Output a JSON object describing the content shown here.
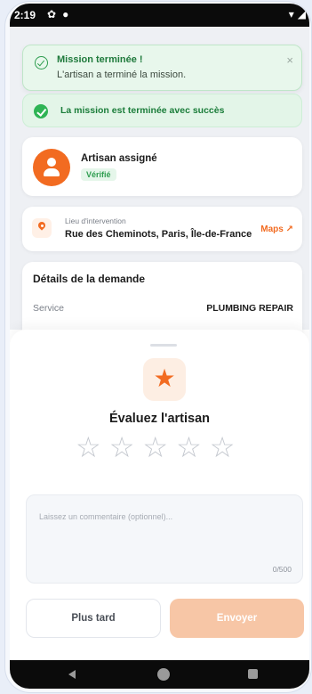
{
  "status_bar": {
    "time": "2:19"
  },
  "toast": {
    "title": "Mission terminée !",
    "message": "L'artisan a terminé la mission.",
    "close": "×"
  },
  "success_banner": {
    "text": "La mission est terminée avec succès"
  },
  "artisan_card": {
    "name": "Artisan assigné",
    "badge": "Vérifié"
  },
  "location_card": {
    "label": "Lieu d'intervention",
    "address": "Rue des Cheminots, Paris, Île-de-France",
    "maps_link": "Maps"
  },
  "details_card": {
    "title": "Détails de la demande",
    "rows": [
      {
        "label": "Service",
        "value": "PLUMBING REPAIR"
      }
    ]
  },
  "rating_sheet": {
    "title": "Évaluez l'artisan",
    "stars_total": 5,
    "stars_selected": 0,
    "comment_placeholder": "Laissez un commentaire (optionnel)...",
    "char_count": "0/500",
    "later_button": "Plus tard",
    "send_button": "Envoyer"
  },
  "colors": {
    "accent": "#f26b21",
    "success": "#2fb455",
    "send_disabled": "#f7c6a6"
  }
}
